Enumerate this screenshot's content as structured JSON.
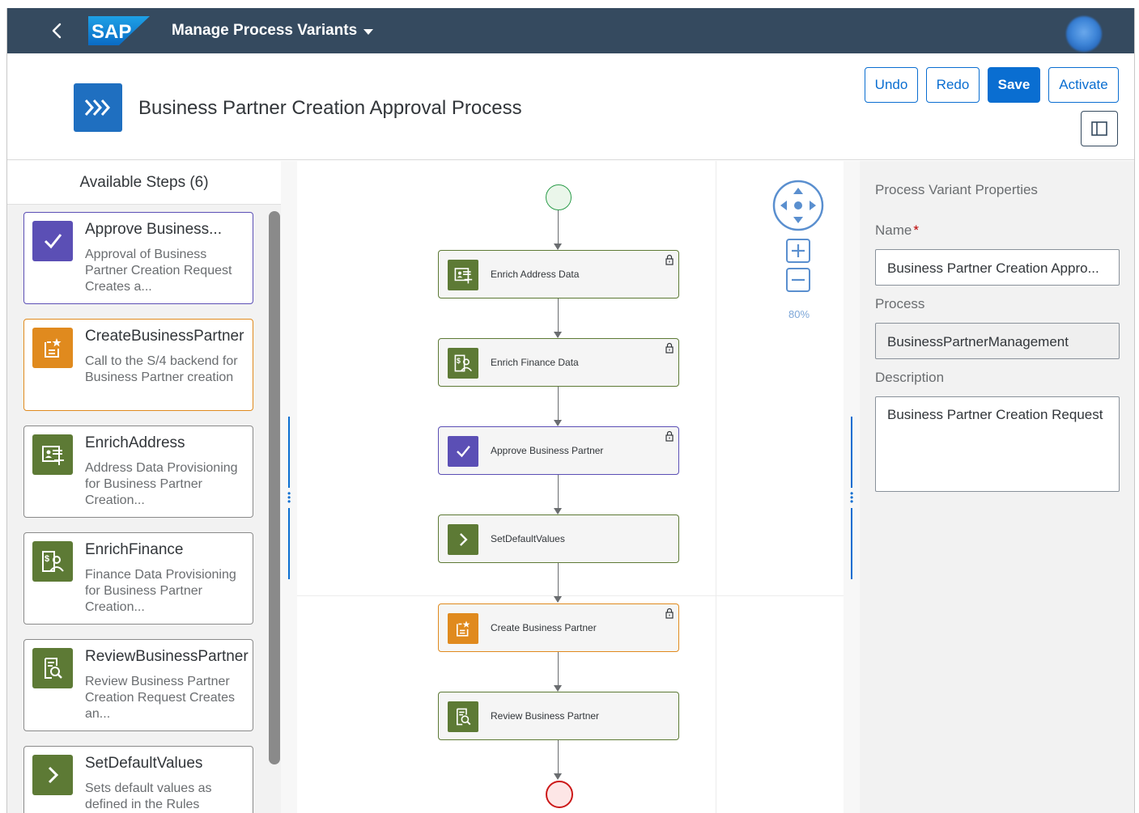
{
  "shell": {
    "logo_text": "SAP",
    "app_title": "Manage Process Variants"
  },
  "header": {
    "title": "Business Partner Creation Approval Process",
    "buttons": {
      "undo": "Undo",
      "redo": "Redo",
      "save": "Save",
      "activate": "Activate"
    }
  },
  "steps_panel": {
    "title": "Available Steps (6)",
    "steps": [
      {
        "title": "Approve Business...",
        "desc": "Approval of Business Partner Creation Request Creates a...",
        "icon": "check-icon",
        "color": "#5b4fb5"
      },
      {
        "title": "CreateBusinessPartner",
        "desc": "Call to the S/4 backend for Business Partner creation",
        "icon": "document-star-icon",
        "color": "#e08a1e"
      },
      {
        "title": "EnrichAddress",
        "desc": "Address Data Provisioning for Business Partner Creation...",
        "icon": "address-card-icon",
        "color": "#5d7a35"
      },
      {
        "title": "EnrichFinance",
        "desc": "Finance Data Provisioning for Business Partner Creation...",
        "icon": "finance-icon",
        "color": "#5d7a35"
      },
      {
        "title": "ReviewBusinessPartner",
        "desc": "Review Business Partner Creation Request Creates an...",
        "icon": "document-review-icon",
        "color": "#5d7a35"
      },
      {
        "title": "SetDefaultValues",
        "desc": "Sets default values as defined in the Rules",
        "icon": "chevron-right-icon",
        "color": "#5d7a35"
      }
    ]
  },
  "flow": {
    "nodes": [
      {
        "label": "Enrich Address Data",
        "icon": "address-card-icon",
        "locked": true
      },
      {
        "label": "Enrich Finance Data",
        "icon": "finance-icon",
        "locked": true
      },
      {
        "label": "Approve Business Partner",
        "icon": "check-icon",
        "locked": true
      },
      {
        "label": "SetDefaultValues",
        "icon": "chevron-right-icon",
        "locked": false
      },
      {
        "label": "Create Business Partner",
        "icon": "document-star-icon",
        "locked": true
      },
      {
        "label": "Review Business Partner",
        "icon": "document-review-icon",
        "locked": false
      }
    ],
    "zoom": "80%"
  },
  "properties": {
    "title": "Process Variant Properties",
    "name_label": "Name",
    "name_required": "*",
    "name_value": "Business Partner Creation Appro...",
    "process_label": "Process",
    "process_value": "BusinessPartnerManagement",
    "description_label": "Description",
    "description_value": "Business Partner Creation Request"
  }
}
